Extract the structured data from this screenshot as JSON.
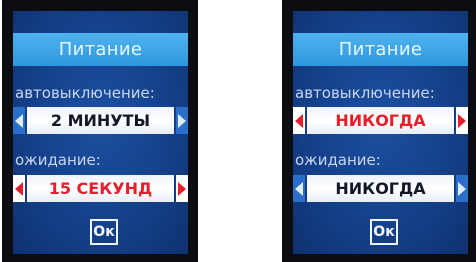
{
  "screens": [
    {
      "title": "Питание",
      "auto_off": {
        "label": "автовыключение:",
        "value": "2 МИНУТЫ",
        "highlighted": false
      },
      "standby": {
        "label": "ожидание:",
        "value": "15 СЕКУНД",
        "highlighted": true
      },
      "ok_label": "Ок"
    },
    {
      "title": "Питание",
      "auto_off": {
        "label": "автовыключение:",
        "value": "НИКОГДА",
        "highlighted": true
      },
      "standby": {
        "label": "ожидание:",
        "value": "НИКОГДА",
        "highlighted": false
      },
      "ok_label": "Ок"
    }
  ],
  "icons": {
    "prev": "chevron-left-icon",
    "next": "chevron-right-icon"
  },
  "colors": {
    "title_bar": "#2f97de",
    "screen_bg": "#15418a",
    "highlight_text": "#e5202c",
    "normal_text": "#111827"
  }
}
